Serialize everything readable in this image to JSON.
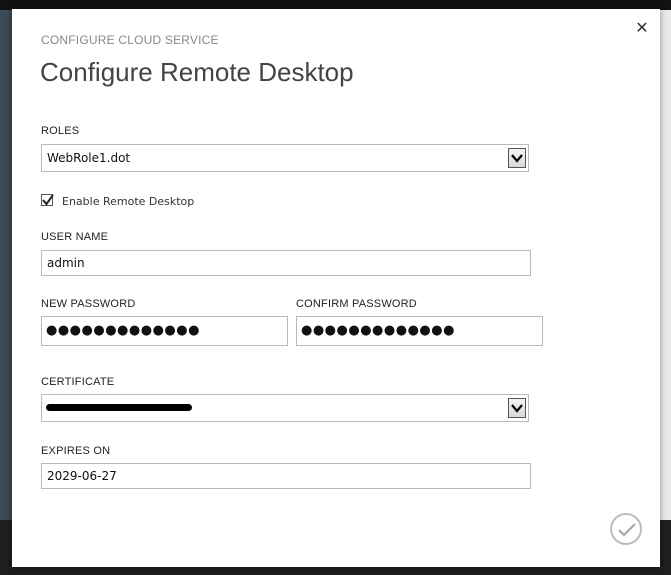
{
  "dialog": {
    "subtitle": "CONFIGURE CLOUD SERVICE",
    "title": "Configure Remote Desktop",
    "close_icon": "close-icon",
    "ok_icon": "checkmark-icon"
  },
  "roles": {
    "label": "ROLES",
    "selected": "WebRole1.dot"
  },
  "enable_rdp": {
    "label": "Enable Remote Desktop",
    "checked": true
  },
  "username": {
    "label": "USER NAME",
    "value": "admin"
  },
  "new_password": {
    "label": "NEW PASSWORD",
    "masked": "●●●●●●●●●●●●●"
  },
  "confirm_password": {
    "label": "CONFIRM PASSWORD",
    "masked": "●●●●●●●●●●●●●"
  },
  "certificate": {
    "label": "CERTIFICATE"
  },
  "expires": {
    "label": "EXPIRES ON",
    "value": "2029-06-27"
  },
  "colors": {
    "title": "#444444",
    "subtitle": "#888888",
    "border": "#b9b9b9"
  }
}
